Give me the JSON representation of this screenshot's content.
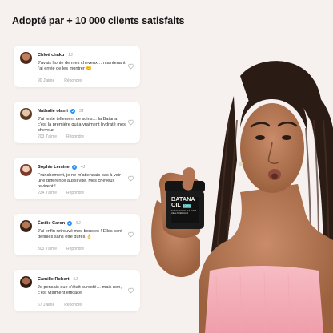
{
  "header": {
    "title": "Adopté par + 10 000 clients satisfaits"
  },
  "product": {
    "brand_line1": "BATANA",
    "brand_line2": "OIL",
    "badge": "100%",
    "tagline": "FOR THICKER, FULLER & HEALTHIER HAIR"
  },
  "colors": {
    "background": "#f6f0ef",
    "card": "#ffffff",
    "verified": "#2f8ef5",
    "top": "#f4aeb7"
  },
  "reviews": [
    {
      "name": "Chloé chaku",
      "time": "1J",
      "verified": false,
      "text": "J'avais honte de mes cheveux… maintenant j'ai envie de les montrer 😊",
      "likes": "90 J'aime",
      "reply": "Répondre"
    },
    {
      "name": "Nathalie olami",
      "time": "3J",
      "verified": true,
      "text": "J'ai testé tellement de soins… la Batana c'est la première qui a vraiment hydraté mes cheveux",
      "likes": "203 J'aime",
      "reply": "Répondre"
    },
    {
      "name": "Sophie Lemine",
      "time": "4J",
      "verified": true,
      "text": "Franchement, je ne m'attendais pas à voir une différence aussi vite. Mes cheveux revivent !",
      "likes": "234 J'aime",
      "reply": "Répondre"
    },
    {
      "name": "Émilie Caron",
      "time": "5J",
      "verified": true,
      "text": "J'ai enfin retrouvé mes boucles ! Elles sont définies sans être dures 👌",
      "likes": "303 J'aime",
      "reply": "Répondre"
    },
    {
      "name": "Camille Robert",
      "time": "5J",
      "verified": false,
      "text": "Je pensais que c'était surcoté… mais non, c'est vraiment efficace",
      "likes": "67 J'aime",
      "reply": "Répondre"
    }
  ]
}
